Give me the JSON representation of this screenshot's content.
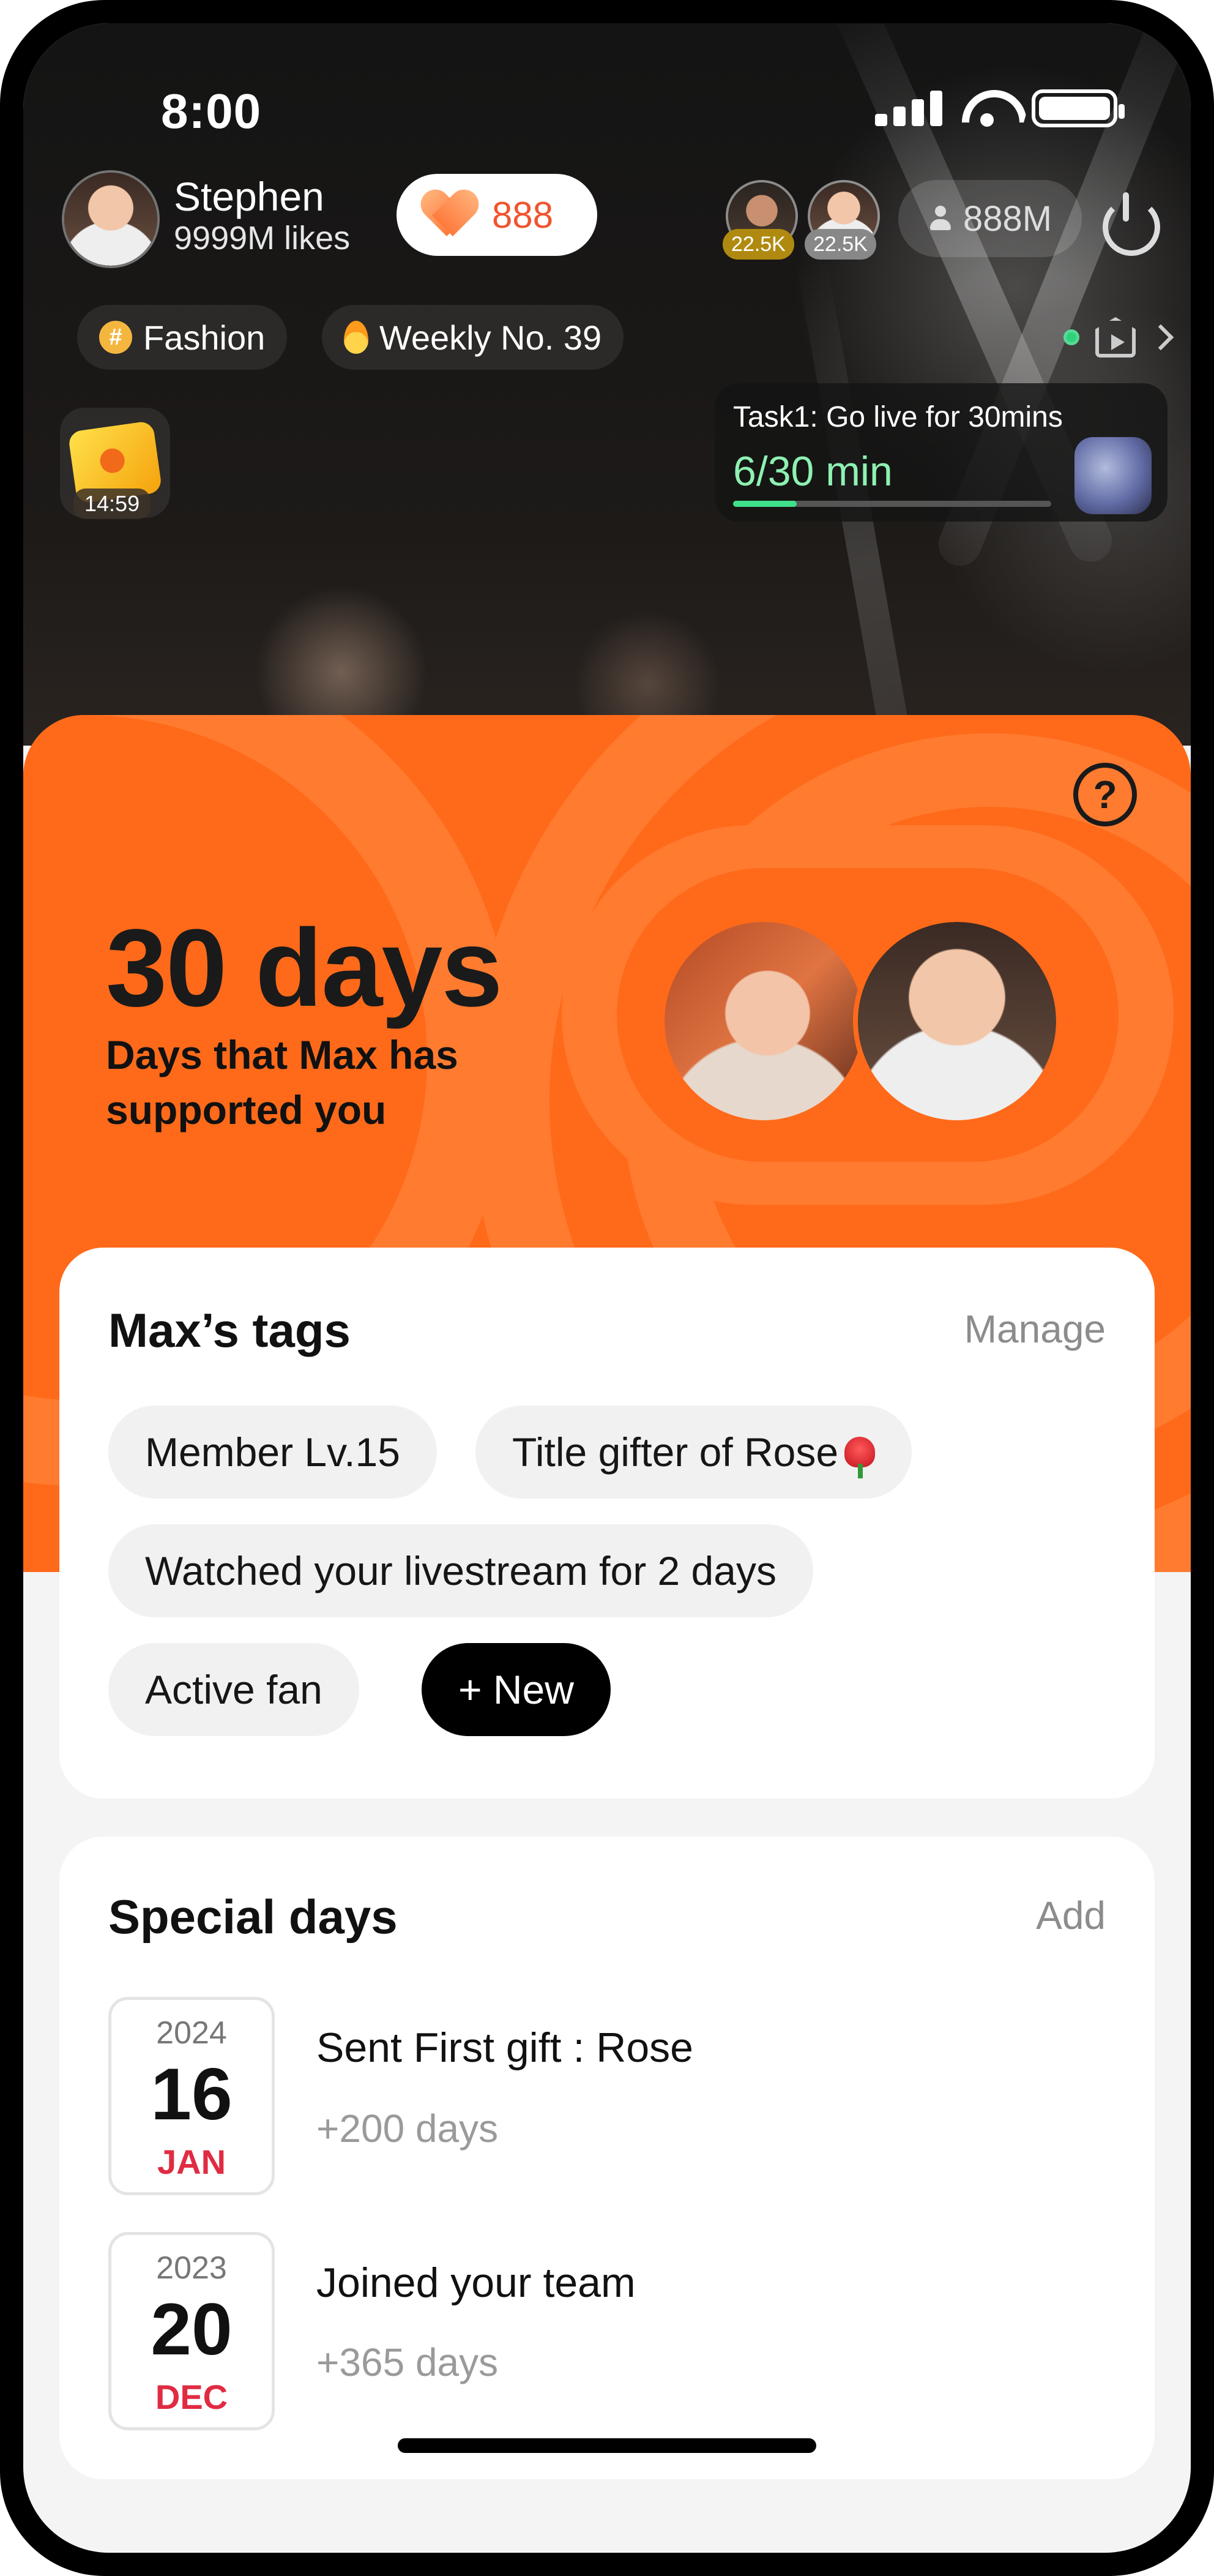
{
  "status_bar": {
    "time": "8:00"
  },
  "host": {
    "name": "Stephen",
    "likes": "9999M likes",
    "like_count": "888"
  },
  "top_viewers": [
    {
      "badge": "22.5K"
    },
    {
      "badge": "22.5K"
    }
  ],
  "viewer_count": "888M",
  "chips": [
    {
      "label": "Fashion",
      "icon": "hash-icon"
    },
    {
      "label": "Weekly No. 39",
      "icon": "flame-icon"
    }
  ],
  "gift_timer": "14:59",
  "task": {
    "title": "Task1: Go live for 30mins",
    "progress_text": "6/30 min",
    "progress_fraction": 0.2
  },
  "support": {
    "days": "30 days",
    "subtitle": "Days that Max has supported you"
  },
  "tags_card": {
    "title": "Max’s tags",
    "action": "Manage",
    "tags": [
      "Member Lv.15",
      "Title gifter of Rose",
      "Watched your livestream for 2 days",
      "Active fan"
    ],
    "new_label": "+ New"
  },
  "special_days": {
    "title": "Special days",
    "action": "Add",
    "items": [
      {
        "year": "2024",
        "day": "16",
        "month": "JAN",
        "title": "Sent First gift : Rose",
        "sub": "+200 days"
      },
      {
        "year": "2023",
        "day": "20",
        "month": "DEC",
        "title": "Joined your team",
        "sub": "+365 days"
      }
    ]
  },
  "colors": {
    "orange": "#ff6a1a",
    "accent_red": "#e02c43",
    "progress_green": "#3fe08a"
  }
}
